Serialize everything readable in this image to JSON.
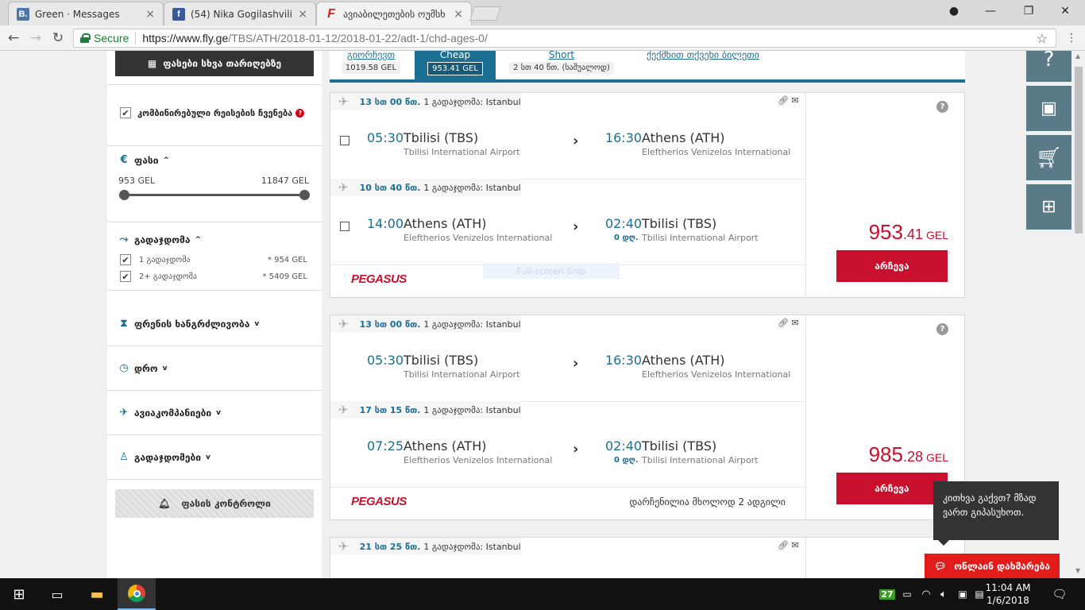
{
  "browser": {
    "tabs": [
      {
        "favicon": "B.",
        "title": "Green · Messages",
        "color": "#4a76a8"
      },
      {
        "favicon": "f",
        "title": "(54) Nika Gogilashvili",
        "color": "#3b5998"
      },
      {
        "favicon": "F",
        "title": "ავიაბილეთების ოუმსხ",
        "color": "#e21b1b"
      }
    ],
    "secure_label": "Secure",
    "url_host": "https://www.fly.ge",
    "url_path": "/TBS/ATH/2018-01-12/2018-01-22/adt-1/chd-ages-0/"
  },
  "sidebar": {
    "date_button": "ფასები სხვა თარიღებზე",
    "combined_label": "კომბინირებული რეისების ჩვენება",
    "price_title": "ფასი",
    "price_min": "953 GEL",
    "price_max": "11847 GEL",
    "stops_title": "გადაჯდომა",
    "stops_options": [
      {
        "label": "1 გადაჯდომა",
        "price": "* 954 GEL"
      },
      {
        "label": "2+ გადაჯდომა",
        "price": "* 5409 GEL"
      }
    ],
    "filters": [
      {
        "label": "ფრენის ხანგრძლივობა",
        "icon": "hourglass-icon"
      },
      {
        "label": "დრო",
        "icon": "clock-icon"
      },
      {
        "label": "ავიაკომპანიები",
        "icon": "plane-icon"
      },
      {
        "label": "გადაჯდომები",
        "icon": "person-icon"
      }
    ],
    "price_control": "ფასის კონტროლი"
  },
  "sort_tabs": [
    {
      "label": "გიორჩევთ",
      "value": "1019.58 GEL"
    },
    {
      "label": "Cheap",
      "value": "953.41 GEL"
    },
    {
      "label": "Short",
      "value": "2 სთ 40 წთ. (საშუალოდ)"
    },
    {
      "label": "ქექმნით თქვენი ბილეთი",
      "value": ""
    }
  ],
  "results": [
    {
      "legs": [
        {
          "duration": "13 სთ 00 წთ.",
          "stops": "1 გადაჯდომა: Istanbul",
          "dep_time": "05:30",
          "dep_city": "Tbilisi (TBS)",
          "dep_airport": "Tbilisi International Airport",
          "arr_time": "16:30",
          "arr_city": "Athens (ATH)",
          "arr_airport": "Eleftherios Venizelos International",
          "day_shift": ""
        },
        {
          "duration": "10 სთ 40 წთ.",
          "stops": "1 გადაჯდომა: Istanbul",
          "dep_time": "14:00",
          "dep_city": "Athens (ATH)",
          "dep_airport": "Eleftherios Venizelos International",
          "arr_time": "02:40",
          "arr_city": "Tbilisi (TBS)",
          "arr_airport": "Tbilisi International Airport",
          "day_shift": "0 დღ."
        }
      ],
      "airline": "PEGASUS",
      "price_int": "953",
      "price_dec": ".41",
      "currency": "GEL",
      "buy_label": "არჩევა",
      "seats_left": ""
    },
    {
      "legs": [
        {
          "duration": "13 სთ 00 წთ.",
          "stops": "1 გადაჯდომა: Istanbul",
          "dep_time": "05:30",
          "dep_city": "Tbilisi (TBS)",
          "dep_airport": "Tbilisi International Airport",
          "arr_time": "16:30",
          "arr_city": "Athens (ATH)",
          "arr_airport": "Eleftherios Venizelos International",
          "day_shift": ""
        },
        {
          "duration": "17 სთ 15 წთ.",
          "stops": "1 გადაჯდომა: Istanbul",
          "dep_time": "07:25",
          "dep_city": "Athens (ATH)",
          "dep_airport": "Eleftherios Venizelos International",
          "arr_time": "02:40",
          "arr_city": "Tbilisi (TBS)",
          "arr_airport": "Tbilisi International Airport",
          "day_shift": "0 დღ."
        }
      ],
      "airline": "PEGASUS",
      "price_int": "985",
      "price_dec": ".28",
      "currency": "GEL",
      "buy_label": "არჩევა",
      "seats_left": "დარჩენილია მხოლოდ 2 ადგილი"
    },
    {
      "legs": [
        {
          "duration": "21 სთ 25 წთ.",
          "stops": "1 გადაჯდომა: Istanbul"
        }
      ]
    }
  ],
  "overlay_snip": "Full-screen Snip",
  "tooltip_text": "კითხვა გაქვთ? მზად ვართ გიპასუხოთ.",
  "chat_button": "ონლაინ დახმარება",
  "taskbar": {
    "time": "11:04 AM",
    "date": "1/6/2018",
    "badge": "27"
  }
}
